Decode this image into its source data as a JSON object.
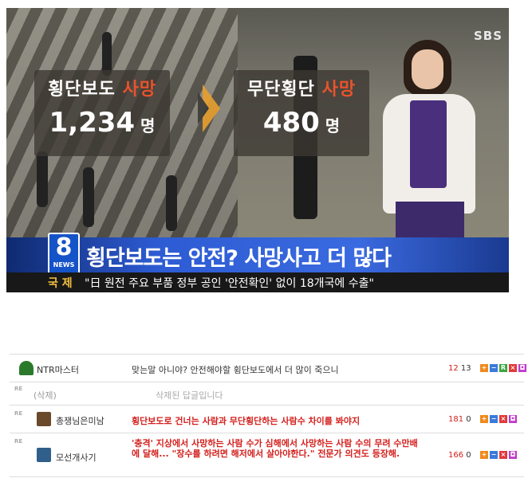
{
  "news": {
    "left_label_a": "횡단보도",
    "left_label_b": "사망",
    "left_value": "1,234",
    "left_unit": "명",
    "right_label_a": "무단횡단",
    "right_label_b": "사망",
    "right_value": "480",
    "right_unit": "명",
    "channel": "SBS",
    "logo_number": "8",
    "logo_text": "NEWS",
    "headline": "횡단보도는 안전? 사망사고 더 많다",
    "ticker_category": "국 제",
    "ticker_text": "\"日 원전 주요 부품 정부 공인 '안전확인' 없이 18개국에 수출\"",
    "colors": {
      "accent_red": "#e8532b",
      "caption_blue": "#2d5bd3",
      "ticker_yellow": "#f0c040"
    }
  },
  "comments": [
    {
      "is_reply": false,
      "nickname": "NTR마스터",
      "text": "맞는말 아니야? 안전해야할 횡단보도에서 더 많이 죽으니",
      "up": "12",
      "down": "13",
      "style": "normal"
    },
    {
      "is_reply": true,
      "re_label": "RE",
      "nickname": "(삭제)",
      "text": "삭제된 답글입니다",
      "up": "",
      "down": "",
      "style": "gray"
    },
    {
      "is_reply": true,
      "re_label": "RE",
      "nickname": "총쟁님은미남",
      "text": "횡단보도로 건너는 사람과 무단횡단하는 사람수 차이를 봐야지",
      "up": "181",
      "down": "0",
      "style": "red"
    },
    {
      "is_reply": true,
      "re_label": "RE",
      "nickname": "모선개사기",
      "text": "'충격' 지상에서 사망하는 사람 수가 심해에서 사망하는 사람 수의 무려 수만배에 달해... \"장수를 하려면 해저에서 살아야한다.\" 전문가 의견도 등장해.",
      "up": "166",
      "down": "0",
      "style": "red"
    }
  ],
  "action_buttons": [
    {
      "symbol": "+",
      "color": "#f08a1c"
    },
    {
      "symbol": "−",
      "color": "#3b7bd8"
    },
    {
      "symbol": "R",
      "color": "#3aa640"
    },
    {
      "symbol": "×",
      "color": "#e03a3a"
    },
    {
      "symbol": "◘",
      "color": "#c03ac8"
    }
  ]
}
